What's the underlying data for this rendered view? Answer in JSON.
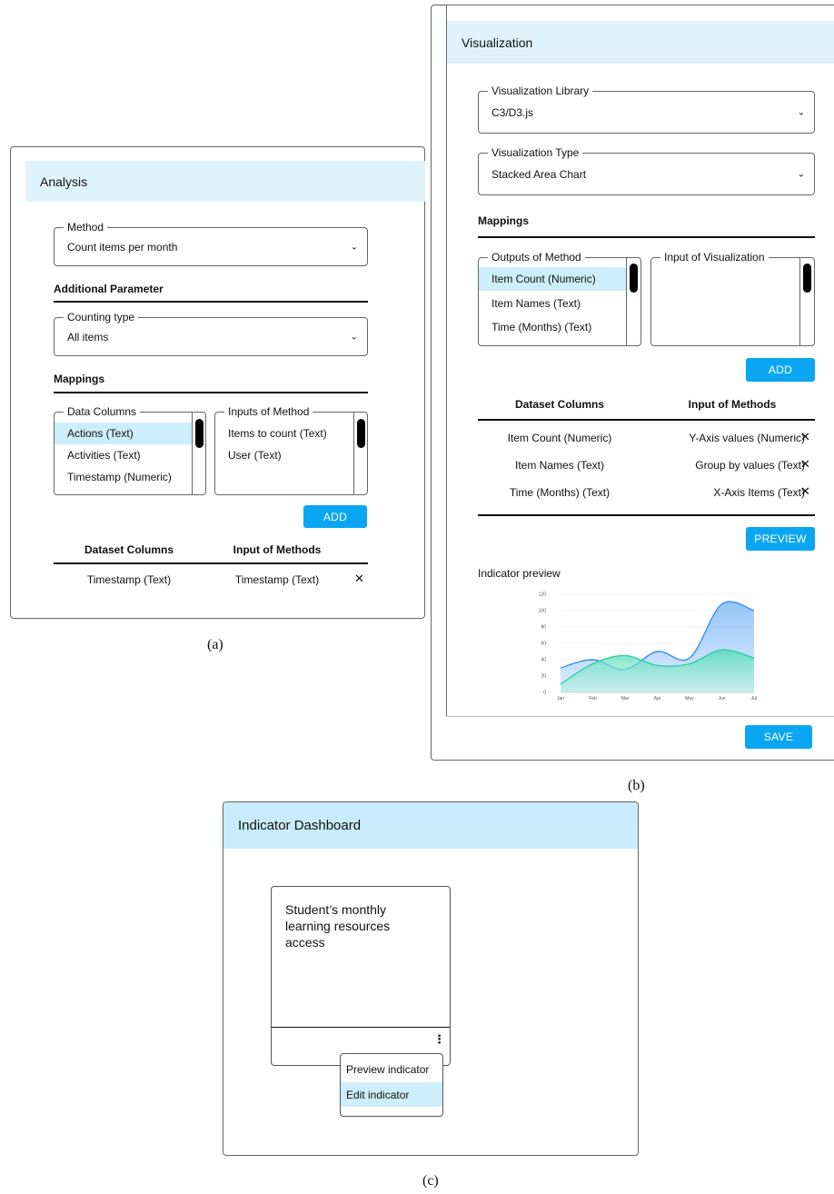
{
  "analysis": {
    "title": "Analysis",
    "method": {
      "label": "Method",
      "value": "Count items per month"
    },
    "additional_parameter": "Additional Parameter",
    "counting_type": {
      "label": "Counting type",
      "value": "All items"
    },
    "mappings": "Mappings",
    "data_columns": {
      "label": "Data Columns",
      "items": [
        "Actions (Text)",
        "Activities (Text)",
        "Timestamp (Numeric)"
      ]
    },
    "inputs_of_method": {
      "label": "Inputs of Method",
      "items": [
        "Items to count (Text)",
        "User (Text)"
      ]
    },
    "add_label": "ADD",
    "table": {
      "headers": [
        "Dataset Columns",
        "Input of Methods"
      ],
      "rows": [
        [
          "Timestamp (Text)",
          "Timestamp (Text)"
        ]
      ]
    },
    "caption": "(a)"
  },
  "visualization": {
    "title": "Visualization",
    "library": {
      "label": "Visualization Library",
      "value": "C3/D3.js"
    },
    "type": {
      "label": "Visualization Type",
      "value": "Stacked Area Chart"
    },
    "mappings": "Mappings",
    "outputs_of_method": {
      "label": "Outputs of Method",
      "items": [
        "Item Count (Numeric)",
        "Item Names (Text)",
        "Time (Months) (Text)"
      ]
    },
    "input_of_visualization": {
      "label": "Input of Visualization"
    },
    "add_label": "ADD",
    "table": {
      "headers": [
        "Dataset Columns",
        "Input of Methods"
      ],
      "rows": [
        [
          "Item Count (Numeric)",
          "Y-Axis values (Numeric)"
        ],
        [
          "Item Names (Text)",
          "Group by values (Text)"
        ],
        [
          "Time (Months) (Text)",
          "X-Axis Items (Text)"
        ]
      ]
    },
    "preview_label": "PREVIEW",
    "indicator_preview": "Indicator preview",
    "save_label": "SAVE",
    "caption": "(b)"
  },
  "chart_data": {
    "type": "area",
    "categories": [
      "Jan",
      "Feb",
      "Mar",
      "Apr",
      "May",
      "Jun",
      "Jul"
    ],
    "y_ticks": [
      "120",
      "100",
      "80",
      "60",
      "40",
      "20",
      "0"
    ],
    "ylim": [
      0,
      120
    ],
    "grid": true,
    "series": [
      {
        "values": [
          30,
          40,
          28,
          50,
          42,
          108,
          100
        ],
        "color": "#3d8fef"
      },
      {
        "values": [
          10,
          35,
          45,
          33,
          35,
          52,
          42
        ],
        "color": "#2dcfa8"
      }
    ]
  },
  "dashboard": {
    "title": "Indicator Dashboard",
    "card_title": "Student’s monthly learning resources access",
    "menu": [
      "Preview indicator",
      "Edit indicator"
    ],
    "caption": "(c)"
  },
  "colors": {
    "header_bg": "#dff3fd",
    "accent": "#0aa6f2",
    "selected": "#cdeefc"
  }
}
